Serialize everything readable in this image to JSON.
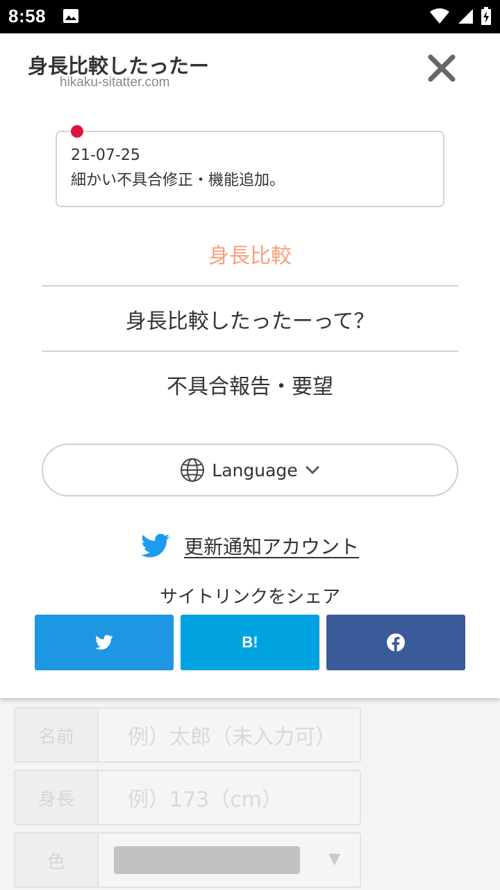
{
  "status_bar": {
    "time": "8:58"
  },
  "header": {
    "title": "身長比較したったー",
    "url": "hikaku-sitatter.com"
  },
  "news": {
    "date": "21-07-25",
    "text": "細かい不具合修正・機能追加。"
  },
  "menu": {
    "items": [
      {
        "label": "身長比較",
        "active": true
      },
      {
        "label": "身長比較したったーって？",
        "active": false
      },
      {
        "label": "不具合報告・要望",
        "active": false
      }
    ]
  },
  "language": {
    "label": "Language"
  },
  "update_account": {
    "label": "更新通知アカウント"
  },
  "share": {
    "title": "サイトリンクをシェア",
    "hatena_label": "B!"
  },
  "background_form": {
    "name_label": "名前",
    "name_placeholder": "例）太郎（未入力可）",
    "height_label": "身長",
    "height_placeholder": "例）173（cm）",
    "color_label": "色"
  },
  "colors": {
    "accent_active": "#f5a07b",
    "news_dot": "#dc143c",
    "twitter": "#1d96e3",
    "hatena": "#00a3e0",
    "facebook": "#3b5a9a"
  }
}
